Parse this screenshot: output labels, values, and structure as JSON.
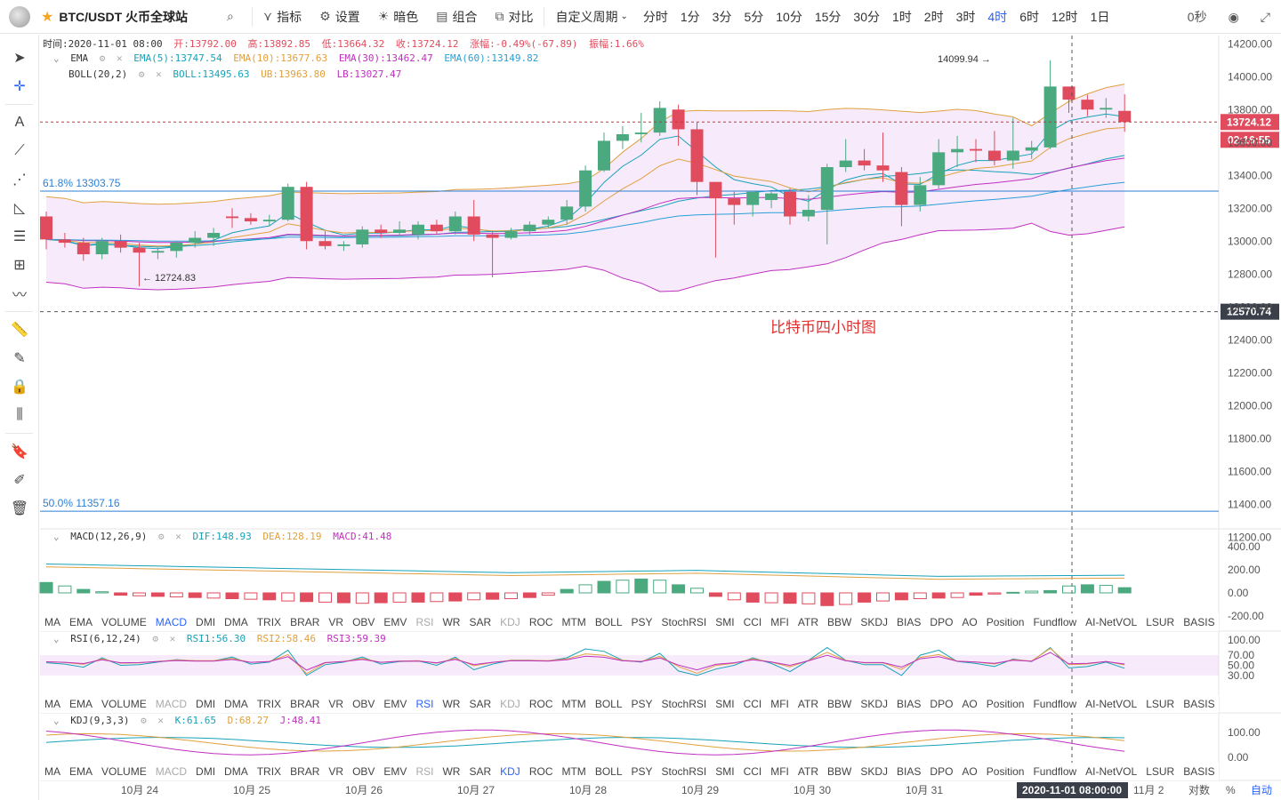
{
  "toolbar": {
    "symbol": "BTC/USDT 火币全球站",
    "indicators": "指标",
    "settings": "设置",
    "dark": "暗色",
    "layout": "组合",
    "compare": "对比",
    "custom_period": "自定义周期",
    "periods": [
      "分时",
      "1分",
      "3分",
      "5分",
      "10分",
      "15分",
      "30分",
      "1时",
      "2时",
      "3时",
      "4时",
      "6时",
      "12时",
      "1日"
    ],
    "active_period": "4时",
    "countdown": "0秒"
  },
  "ohlc_legend": {
    "time": "时间:2020-11-01 08:00",
    "open": "开:13792.00",
    "high": "高:13892.85",
    "low": "低:13664.32",
    "close": "收:13724.12",
    "change": "涨幅:-0.49%(-67.89)",
    "amplitude": "振幅:1.66%"
  },
  "ema_legend": {
    "name": "EMA",
    "ema5": "EMA(5):13747.54",
    "ema10": "EMA(10):13677.63",
    "ema30": "EMA(30):13462.47",
    "ema60": "EMA(60):13149.82"
  },
  "boll_legend": {
    "name": "BOLL(20,2)",
    "boll": "BOLL:13495.63",
    "ub": "UB:13963.80",
    "lb": "LB:13027.47"
  },
  "macd_legend": {
    "name": "MACD(12,26,9)",
    "dif": "DIF:148.93",
    "dea": "DEA:128.19",
    "macd": "MACD:41.48"
  },
  "rsi_legend": {
    "name": "RSI(6,12,24)",
    "rsi1": "RSI1:56.30",
    "rsi2": "RSI2:58.46",
    "rsi3": "RSI3:59.39"
  },
  "kdj_legend": {
    "name": "KDJ(9,3,3)",
    "k": "K:61.65",
    "d": "D:68.27",
    "j": "J:48.41"
  },
  "indicator_tabs": [
    "MA",
    "EMA",
    "VOLUME",
    "MACD",
    "DMI",
    "DMA",
    "TRIX",
    "BRAR",
    "VR",
    "OBV",
    "EMV",
    "RSI",
    "WR",
    "SAR",
    "KDJ",
    "ROC",
    "MTM",
    "BOLL",
    "PSY",
    "StochRSI",
    "SMI",
    "CCI",
    "MFI",
    "ATR",
    "BBW",
    "SKDJ",
    "BIAS",
    "DPO",
    "AO",
    "Position",
    "Fundflow",
    "AI-NetVOL",
    "LSUR",
    "BASIS"
  ],
  "price_axis": [
    "14200.00",
    "14000.00",
    "13800.00",
    "13600.00",
    "13400.00",
    "13200.00",
    "13000.00",
    "12800.00",
    "12600.00",
    "12400.00",
    "12200.00",
    "12000.00",
    "11800.00",
    "11600.00",
    "11400.00",
    "11200.00"
  ],
  "price_tag": "13724.12",
  "countdown_tag": "02:16:55",
  "crosshair_price": "12570.74",
  "high_label": "14099.94 →",
  "low_label": "← 12724.83",
  "fib_618": "61.8% 13303.75",
  "fib_50": "50.0% 11357.16",
  "annotation": "比特币四小时图",
  "macd_axis": [
    "400.00",
    "200.00",
    "0.00",
    "-200.00"
  ],
  "rsi_axis": [
    "100.00",
    "70.00",
    "50.00",
    "30.00"
  ],
  "kdj_axis": [
    "100.00",
    "0.00"
  ],
  "time_axis": [
    "10月 24",
    "10月 25",
    "10月 26",
    "10月 27",
    "10月 28",
    "10月 29",
    "10月 30",
    "10月 31"
  ],
  "crosshair_time": "2020-11-01 08:00:00",
  "time_axis_next": "11月 2",
  "bottom_right": {
    "log": "对数",
    "pct": "%",
    "auto": "自动"
  },
  "colors": {
    "up": "#4aa97f",
    "down": "#e04b5d",
    "accent": "#2962ff"
  },
  "chart_data": {
    "type": "candlestick",
    "period": "4时",
    "candles": [
      [
        13150,
        13180,
        12950,
        13010
      ],
      [
        13010,
        13050,
        12960,
        12990
      ],
      [
        12990,
        13020,
        12880,
        12920
      ],
      [
        12920,
        13020,
        12890,
        13000
      ],
      [
        13000,
        13040,
        12930,
        12960
      ],
      [
        12960,
        12990,
        12724.83,
        12930
      ],
      [
        12930,
        12960,
        12890,
        12940
      ],
      [
        12940,
        13000,
        12900,
        12990
      ],
      [
        12990,
        13060,
        12960,
        13020
      ],
      [
        13020,
        13080,
        12970,
        13050
      ],
      [
        13150,
        13200,
        13080,
        13140
      ],
      [
        13140,
        13170,
        13100,
        13120
      ],
      [
        13120,
        13160,
        13090,
        13130
      ],
      [
        13130,
        13350,
        13120,
        13330
      ],
      [
        13330,
        13360,
        12950,
        13000
      ],
      [
        13000,
        13060,
        12950,
        12970
      ],
      [
        12970,
        13000,
        12940,
        12980
      ],
      [
        12980,
        13090,
        12960,
        13070
      ],
      [
        13070,
        13100,
        13020,
        13050
      ],
      [
        13050,
        13120,
        13030,
        13070
      ],
      [
        13040,
        13120,
        13010,
        13100
      ],
      [
        13100,
        13130,
        13040,
        13060
      ],
      [
        13060,
        13180,
        13040,
        13150
      ],
      [
        13150,
        13250,
        13000,
        13040
      ],
      [
        13040,
        13060,
        12780,
        13020
      ],
      [
        13020,
        13080,
        13010,
        13060
      ],
      [
        13060,
        13120,
        13040,
        13100
      ],
      [
        13100,
        13150,
        13080,
        13130
      ],
      [
        13130,
        13250,
        13100,
        13210
      ],
      [
        13210,
        13460,
        13180,
        13430
      ],
      [
        13430,
        13660,
        13420,
        13610
      ],
      [
        13610,
        13700,
        13560,
        13650
      ],
      [
        13650,
        13780,
        13600,
        13660
      ],
      [
        13660,
        13850,
        13640,
        13810
      ],
      [
        13800,
        13830,
        13580,
        13680
      ],
      [
        13680,
        13720,
        13280,
        13360
      ],
      [
        13360,
        13340,
        12900,
        13260
      ],
      [
        13260,
        13300,
        13100,
        13220
      ],
      [
        13220,
        13280,
        13150,
        13300
      ],
      [
        13250,
        13300,
        13200,
        13290
      ],
      [
        13300,
        13320,
        13100,
        13150
      ],
      [
        13150,
        13280,
        13120,
        13190
      ],
      [
        13190,
        13470,
        12980,
        13450
      ],
      [
        13450,
        13620,
        13420,
        13490
      ],
      [
        13490,
        13560,
        13430,
        13460
      ],
      [
        13460,
        13660,
        13360,
        13430
      ],
      [
        13420,
        13450,
        13090,
        13220
      ],
      [
        13220,
        13390,
        13180,
        13340
      ],
      [
        13340,
        13620,
        13320,
        13540
      ],
      [
        13540,
        13640,
        13450,
        13560
      ],
      [
        13560,
        13620,
        13480,
        13550
      ],
      [
        13550,
        13670,
        13460,
        13490
      ],
      [
        13490,
        13750,
        13440,
        13550
      ],
      [
        13550,
        13610,
        13500,
        13570
      ],
      [
        13570,
        14099.94,
        13560,
        13940
      ],
      [
        13940,
        13920,
        13780,
        13860
      ],
      [
        13860,
        13890,
        13760,
        13800
      ],
      [
        13800,
        13870,
        13750,
        13810
      ],
      [
        13792,
        13892.85,
        13664.32,
        13724.12
      ]
    ],
    "y_range": [
      11250,
      14250
    ],
    "fib_levels": [
      {
        "label": "61.8%",
        "value": 13303.75
      },
      {
        "label": "50.0%",
        "value": 11357.16
      }
    ],
    "current_price": 13724.12,
    "crosshair_price": 12570.74,
    "macd_hist": [
      90,
      60,
      30,
      10,
      -20,
      -25,
      -30,
      -35,
      -40,
      -45,
      -50,
      -55,
      -60,
      -70,
      -75,
      -80,
      -85,
      -90,
      -85,
      -80,
      -80,
      -75,
      -70,
      -60,
      -55,
      -50,
      -40,
      -20,
      30,
      70,
      100,
      110,
      120,
      110,
      70,
      40,
      -30,
      -60,
      -80,
      -85,
      -90,
      -95,
      -110,
      -100,
      -80,
      -70,
      -60,
      -50,
      -45,
      -40,
      -20,
      -10,
      5,
      15,
      20,
      60,
      70,
      65,
      45
    ]
  }
}
